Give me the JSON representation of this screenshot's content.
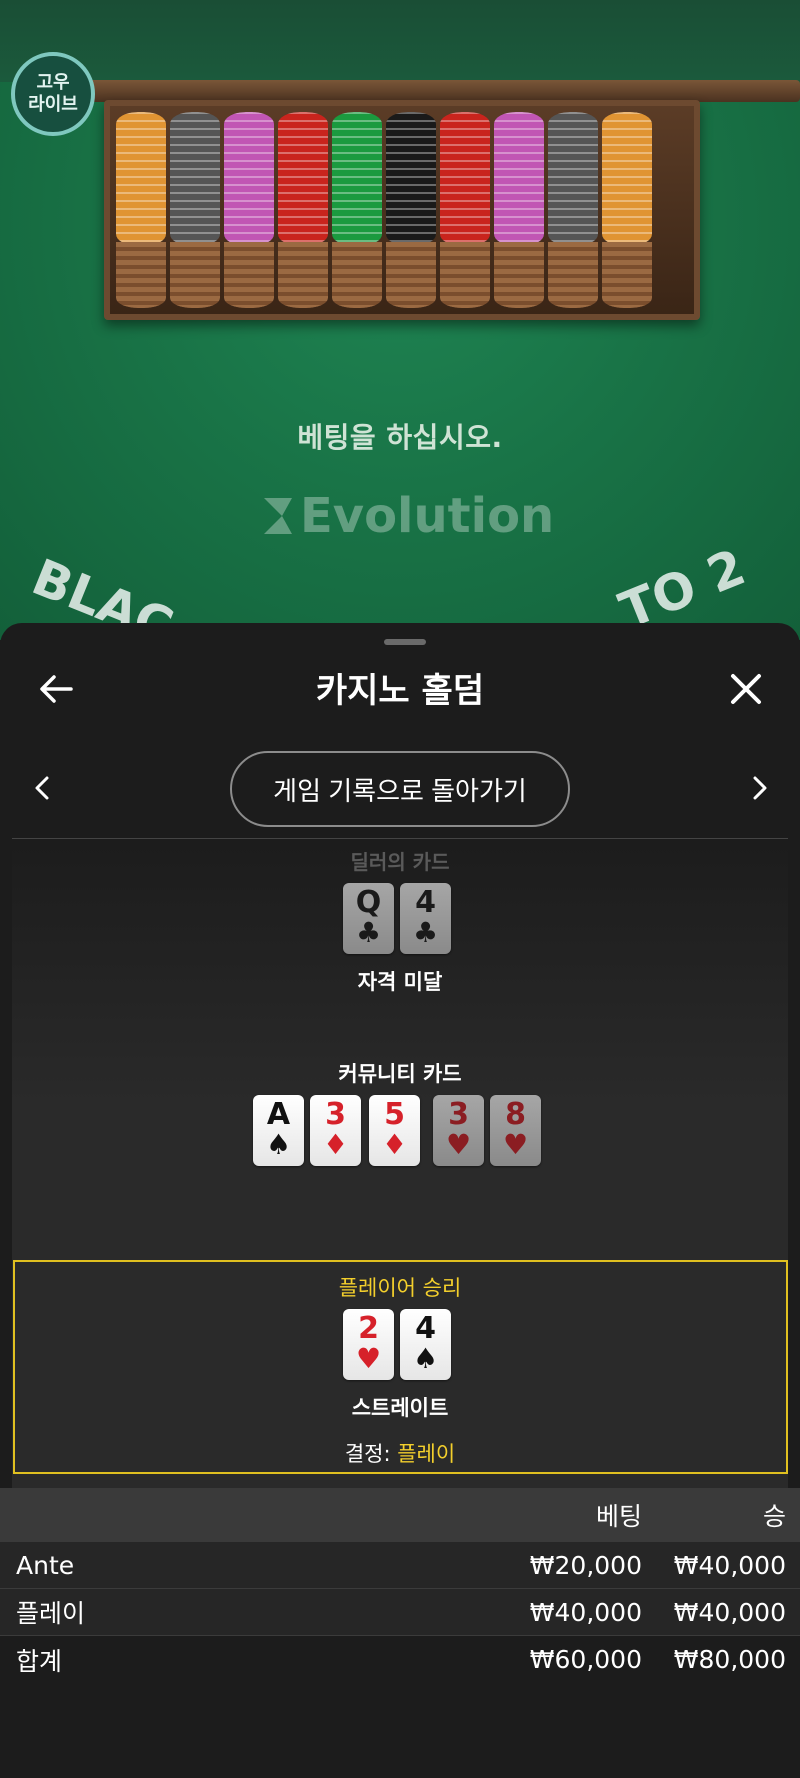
{
  "game_view": {
    "badge_line1": "고우",
    "badge_line2": "라이브",
    "bet_message": "베팅을 하십시오.",
    "provider_logo": "Evolution",
    "table_text_left": "BLAC",
    "table_text_right": "TO 2"
  },
  "sheet": {
    "title": "카지노 홀덤",
    "history_button": "게임 기록으로 돌아가기"
  },
  "dealer": {
    "label": "딜러의 카드",
    "result": "자격 미달",
    "cards": [
      {
        "rank": "Q",
        "suit": "♣",
        "color": "black",
        "dimmed": true
      },
      {
        "rank": "4",
        "suit": "♣",
        "color": "black",
        "dimmed": true
      }
    ]
  },
  "community": {
    "label": "커뮤니티 카드",
    "cards": [
      {
        "rank": "A",
        "suit": "♠",
        "color": "black",
        "dimmed": false
      },
      {
        "rank": "3",
        "suit": "♦",
        "color": "red",
        "dimmed": false
      },
      {
        "rank": "5",
        "suit": "♦",
        "color": "red",
        "dimmed": false
      },
      {
        "rank": "3",
        "suit": "♥",
        "color": "red",
        "dimmed": true
      },
      {
        "rank": "8",
        "suit": "♥",
        "color": "red",
        "dimmed": true
      }
    ]
  },
  "player": {
    "label": "플레이어 승리",
    "hand_name": "스트레이트",
    "decision_label": "결정:",
    "decision_value": "플레이",
    "cards": [
      {
        "rank": "2",
        "suit": "♥",
        "color": "red",
        "dimmed": false
      },
      {
        "rank": "4",
        "suit": "♠",
        "color": "black",
        "dimmed": false
      }
    ]
  },
  "bets": {
    "headers": {
      "bet": "베팅",
      "win": "승"
    },
    "rows": [
      {
        "name": "Ante",
        "bet": "₩20,000",
        "win": "₩40,000"
      },
      {
        "name": "플레이",
        "bet": "₩40,000",
        "win": "₩40,000"
      },
      {
        "name": "합계",
        "bet": "₩60,000",
        "win": "₩80,000"
      }
    ]
  },
  "colors": {
    "table_felt": "#197447",
    "accent_gold": "#f3cf2c",
    "sheet_bg": "#1c1c1c"
  }
}
